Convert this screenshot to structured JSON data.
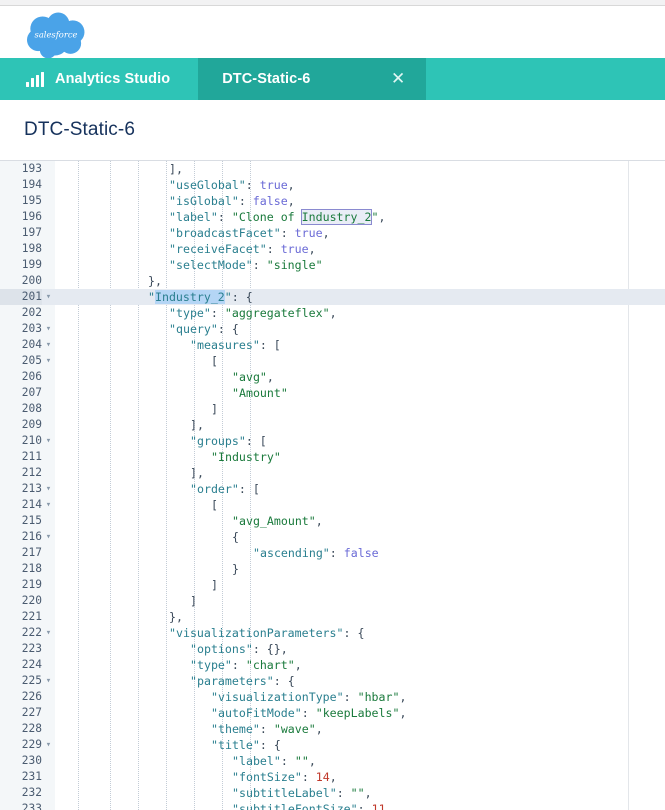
{
  "app": {
    "logo_text": "salesforce",
    "logo_icon": "salesforce-cloud-logo"
  },
  "tabs": {
    "items": [
      {
        "label": "Analytics Studio",
        "icon": "bar-chart-icon",
        "active": false
      },
      {
        "label": "DTC-Static-6",
        "icon": "",
        "active": true,
        "close_icon": "✕"
      }
    ]
  },
  "page": {
    "title": "DTC-Static-6"
  },
  "editor": {
    "active_line": 201,
    "selected_text": "Industry_2",
    "colors": {
      "accent_teal": "#2ec4b6",
      "active_tab_teal": "#21a79a",
      "title_navy": "#16325c",
      "gutter_bg": "#f4f7f9",
      "active_line_bg": "#e5eaf1",
      "selection_bg": "#b4d5f5",
      "key": "#2a7f8f",
      "string": "#1a7a3c",
      "boolean": "#6a6ad6",
      "number": "#c0392b"
    },
    "lines": [
      {
        "n": 193,
        "fold": false,
        "indent": 16,
        "tokens": [
          {
            "t": "],",
            "c": "p"
          }
        ]
      },
      {
        "n": 194,
        "fold": false,
        "indent": 16,
        "tokens": [
          {
            "t": "\"useGlobal\"",
            "c": "k"
          },
          {
            "t": ": ",
            "c": "p"
          },
          {
            "t": "true",
            "c": "b"
          },
          {
            "t": ",",
            "c": "p"
          }
        ]
      },
      {
        "n": 195,
        "fold": false,
        "indent": 16,
        "tokens": [
          {
            "t": "\"isGlobal\"",
            "c": "k"
          },
          {
            "t": ": ",
            "c": "p"
          },
          {
            "t": "false",
            "c": "b"
          },
          {
            "t": ",",
            "c": "p"
          }
        ]
      },
      {
        "n": 196,
        "fold": false,
        "indent": 16,
        "tokens": [
          {
            "t": "\"label\"",
            "c": "k"
          },
          {
            "t": ": ",
            "c": "p"
          },
          {
            "t": "\"Clone of ",
            "c": "s"
          },
          {
            "t": "Industry_2",
            "c": "s match"
          },
          {
            "t": "\"",
            "c": "s"
          },
          {
            "t": ",",
            "c": "p"
          }
        ]
      },
      {
        "n": 197,
        "fold": false,
        "indent": 16,
        "tokens": [
          {
            "t": "\"broadcastFacet\"",
            "c": "k"
          },
          {
            "t": ": ",
            "c": "p"
          },
          {
            "t": "true",
            "c": "b"
          },
          {
            "t": ",",
            "c": "p"
          }
        ]
      },
      {
        "n": 198,
        "fold": false,
        "indent": 16,
        "tokens": [
          {
            "t": "\"receiveFacet\"",
            "c": "k"
          },
          {
            "t": ": ",
            "c": "p"
          },
          {
            "t": "true",
            "c": "b"
          },
          {
            "t": ",",
            "c": "p"
          }
        ]
      },
      {
        "n": 199,
        "fold": false,
        "indent": 16,
        "tokens": [
          {
            "t": "\"selectMode\"",
            "c": "k"
          },
          {
            "t": ": ",
            "c": "p"
          },
          {
            "t": "\"single\"",
            "c": "s"
          }
        ]
      },
      {
        "n": 200,
        "fold": false,
        "indent": 13,
        "tokens": [
          {
            "t": "},",
            "c": "p"
          }
        ]
      },
      {
        "n": 201,
        "fold": true,
        "active": true,
        "indent": 13,
        "tokens": [
          {
            "t": "\"",
            "c": "k"
          },
          {
            "t": "Industry_2",
            "c": "k sel"
          },
          {
            "t": "\"",
            "c": "k"
          },
          {
            "t": ": {",
            "c": "p"
          }
        ]
      },
      {
        "n": 202,
        "fold": false,
        "indent": 16,
        "tokens": [
          {
            "t": "\"type\"",
            "c": "k"
          },
          {
            "t": ": ",
            "c": "p"
          },
          {
            "t": "\"aggregateflex\"",
            "c": "s"
          },
          {
            "t": ",",
            "c": "p"
          }
        ]
      },
      {
        "n": 203,
        "fold": true,
        "indent": 16,
        "tokens": [
          {
            "t": "\"query\"",
            "c": "k"
          },
          {
            "t": ": {",
            "c": "p"
          }
        ]
      },
      {
        "n": 204,
        "fold": true,
        "indent": 19,
        "tokens": [
          {
            "t": "\"measures\"",
            "c": "k"
          },
          {
            "t": ": [",
            "c": "p"
          }
        ]
      },
      {
        "n": 205,
        "fold": true,
        "indent": 22,
        "tokens": [
          {
            "t": "[",
            "c": "p"
          }
        ]
      },
      {
        "n": 206,
        "fold": false,
        "indent": 25,
        "tokens": [
          {
            "t": "\"avg\"",
            "c": "s"
          },
          {
            "t": ",",
            "c": "p"
          }
        ]
      },
      {
        "n": 207,
        "fold": false,
        "indent": 25,
        "tokens": [
          {
            "t": "\"Amount\"",
            "c": "s"
          }
        ]
      },
      {
        "n": 208,
        "fold": false,
        "indent": 22,
        "tokens": [
          {
            "t": "]",
            "c": "p"
          }
        ]
      },
      {
        "n": 209,
        "fold": false,
        "indent": 19,
        "tokens": [
          {
            "t": "],",
            "c": "p"
          }
        ]
      },
      {
        "n": 210,
        "fold": true,
        "indent": 19,
        "tokens": [
          {
            "t": "\"groups\"",
            "c": "k"
          },
          {
            "t": ": [",
            "c": "p"
          }
        ]
      },
      {
        "n": 211,
        "fold": false,
        "indent": 22,
        "tokens": [
          {
            "t": "\"Industry\"",
            "c": "s"
          }
        ]
      },
      {
        "n": 212,
        "fold": false,
        "indent": 19,
        "tokens": [
          {
            "t": "],",
            "c": "p"
          }
        ]
      },
      {
        "n": 213,
        "fold": true,
        "indent": 19,
        "tokens": [
          {
            "t": "\"order\"",
            "c": "k"
          },
          {
            "t": ": [",
            "c": "p"
          }
        ]
      },
      {
        "n": 214,
        "fold": true,
        "indent": 22,
        "tokens": [
          {
            "t": "[",
            "c": "p"
          }
        ]
      },
      {
        "n": 215,
        "fold": false,
        "indent": 25,
        "tokens": [
          {
            "t": "\"avg_Amount\"",
            "c": "s"
          },
          {
            "t": ",",
            "c": "p"
          }
        ]
      },
      {
        "n": 216,
        "fold": true,
        "indent": 25,
        "tokens": [
          {
            "t": "{",
            "c": "p"
          }
        ]
      },
      {
        "n": 217,
        "fold": false,
        "indent": 28,
        "tokens": [
          {
            "t": "\"ascending\"",
            "c": "k"
          },
          {
            "t": ": ",
            "c": "p"
          },
          {
            "t": "false",
            "c": "b"
          }
        ]
      },
      {
        "n": 218,
        "fold": false,
        "indent": 25,
        "tokens": [
          {
            "t": "}",
            "c": "p"
          }
        ]
      },
      {
        "n": 219,
        "fold": false,
        "indent": 22,
        "tokens": [
          {
            "t": "]",
            "c": "p"
          }
        ]
      },
      {
        "n": 220,
        "fold": false,
        "indent": 19,
        "tokens": [
          {
            "t": "]",
            "c": "p"
          }
        ]
      },
      {
        "n": 221,
        "fold": false,
        "indent": 16,
        "tokens": [
          {
            "t": "},",
            "c": "p"
          }
        ]
      },
      {
        "n": 222,
        "fold": true,
        "indent": 16,
        "tokens": [
          {
            "t": "\"visualizationParameters\"",
            "c": "k"
          },
          {
            "t": ": {",
            "c": "p"
          }
        ]
      },
      {
        "n": 223,
        "fold": false,
        "indent": 19,
        "tokens": [
          {
            "t": "\"options\"",
            "c": "k"
          },
          {
            "t": ": {},",
            "c": "p"
          }
        ]
      },
      {
        "n": 224,
        "fold": false,
        "indent": 19,
        "tokens": [
          {
            "t": "\"type\"",
            "c": "k"
          },
          {
            "t": ": ",
            "c": "p"
          },
          {
            "t": "\"chart\"",
            "c": "s"
          },
          {
            "t": ",",
            "c": "p"
          }
        ]
      },
      {
        "n": 225,
        "fold": true,
        "indent": 19,
        "tokens": [
          {
            "t": "\"parameters\"",
            "c": "k"
          },
          {
            "t": ": {",
            "c": "p"
          }
        ]
      },
      {
        "n": 226,
        "fold": false,
        "indent": 22,
        "tokens": [
          {
            "t": "\"visualizationType\"",
            "c": "k"
          },
          {
            "t": ": ",
            "c": "p"
          },
          {
            "t": "\"hbar\"",
            "c": "s"
          },
          {
            "t": ",",
            "c": "p"
          }
        ]
      },
      {
        "n": 227,
        "fold": false,
        "indent": 22,
        "tokens": [
          {
            "t": "\"autoFitMode\"",
            "c": "k"
          },
          {
            "t": ": ",
            "c": "p"
          },
          {
            "t": "\"keepLabels\"",
            "c": "s"
          },
          {
            "t": ",",
            "c": "p"
          }
        ]
      },
      {
        "n": 228,
        "fold": false,
        "indent": 22,
        "tokens": [
          {
            "t": "\"theme\"",
            "c": "k"
          },
          {
            "t": ": ",
            "c": "p"
          },
          {
            "t": "\"wave\"",
            "c": "s"
          },
          {
            "t": ",",
            "c": "p"
          }
        ]
      },
      {
        "n": 229,
        "fold": true,
        "indent": 22,
        "tokens": [
          {
            "t": "\"title\"",
            "c": "k"
          },
          {
            "t": ": {",
            "c": "p"
          }
        ]
      },
      {
        "n": 230,
        "fold": false,
        "indent": 25,
        "tokens": [
          {
            "t": "\"label\"",
            "c": "k"
          },
          {
            "t": ": ",
            "c": "p"
          },
          {
            "t": "\"\"",
            "c": "s"
          },
          {
            "t": ",",
            "c": "p"
          }
        ]
      },
      {
        "n": 231,
        "fold": false,
        "indent": 25,
        "tokens": [
          {
            "t": "\"fontSize\"",
            "c": "k"
          },
          {
            "t": ": ",
            "c": "p"
          },
          {
            "t": "14",
            "c": "n"
          },
          {
            "t": ",",
            "c": "p"
          }
        ]
      },
      {
        "n": 232,
        "fold": false,
        "indent": 25,
        "tokens": [
          {
            "t": "\"subtitleLabel\"",
            "c": "k"
          },
          {
            "t": ": ",
            "c": "p"
          },
          {
            "t": "\"\"",
            "c": "s"
          },
          {
            "t": ",",
            "c": "p"
          }
        ]
      },
      {
        "n": 233,
        "fold": false,
        "indent": 25,
        "tokens": [
          {
            "t": "\"subtitleFontSize\"",
            "c": "k"
          },
          {
            "t": ": ",
            "c": "p"
          },
          {
            "t": "11",
            "c": "n"
          },
          {
            "t": ",",
            "c": "p"
          }
        ]
      }
    ]
  }
}
